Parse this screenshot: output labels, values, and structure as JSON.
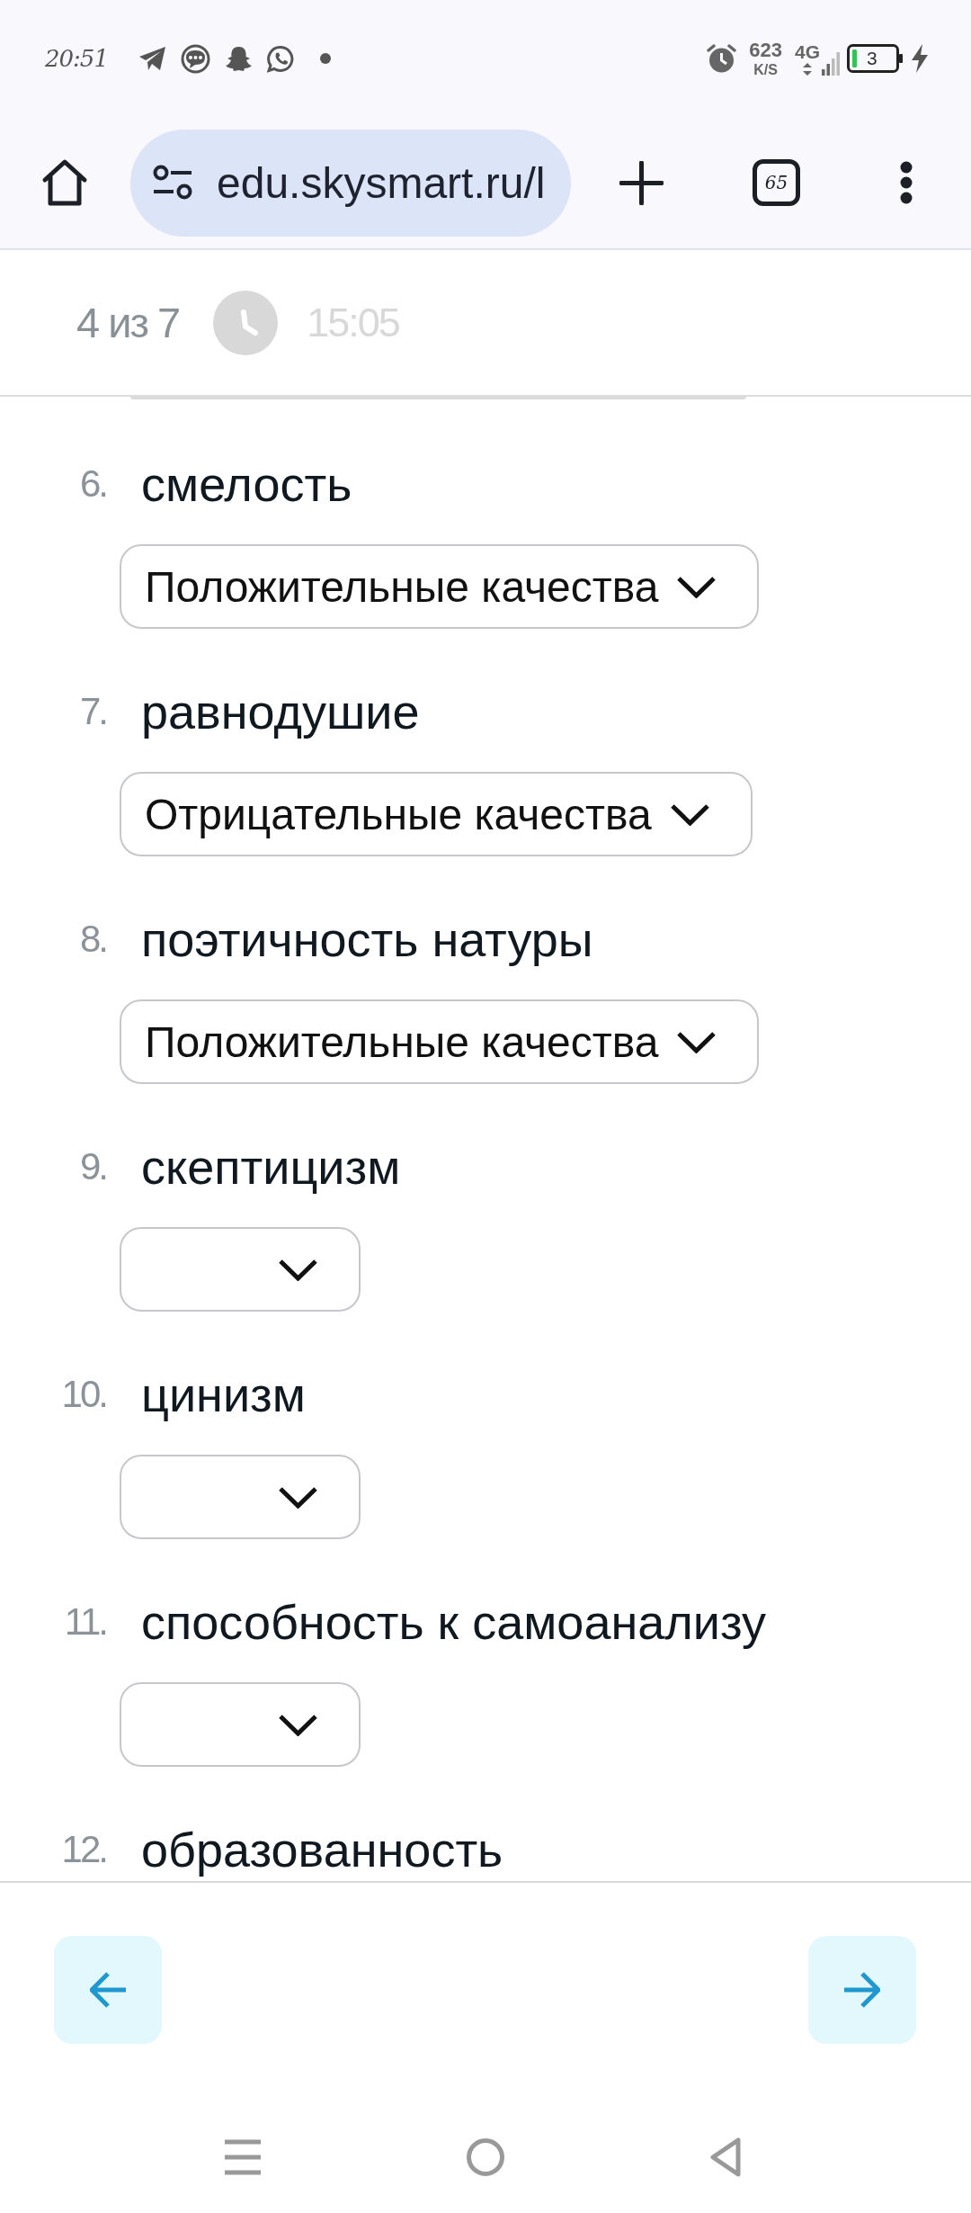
{
  "status_bar": {
    "time": "20:51",
    "net_speed": "623",
    "net_speed_unit": "K/S",
    "network": "4G",
    "battery": "3"
  },
  "browser": {
    "url": "edu.skysmart.ru/l",
    "tab_count": "65"
  },
  "header": {
    "progress": "4 из 7",
    "timer": "15:05"
  },
  "questions": [
    {
      "number": "6.",
      "term": "смелость",
      "dropdown": {
        "empty": false,
        "value": "Положительные качества"
      }
    },
    {
      "number": "7.",
      "term": "равнодушие",
      "dropdown": {
        "empty": false,
        "value": "Отрицательные качества"
      }
    },
    {
      "number": "8.",
      "term": "поэтичность натуры",
      "dropdown": {
        "empty": false,
        "value": "Положительные качества"
      }
    },
    {
      "number": "9.",
      "term": "скептицизм",
      "dropdown": {
        "empty": true
      }
    },
    {
      "number": "10.",
      "term": "цинизм",
      "dropdown": {
        "empty": true
      }
    },
    {
      "number": "11.",
      "term": "способность к самоанализу",
      "dropdown": {
        "empty": true
      }
    },
    {
      "number": "12.",
      "term": "образованность"
    }
  ]
}
